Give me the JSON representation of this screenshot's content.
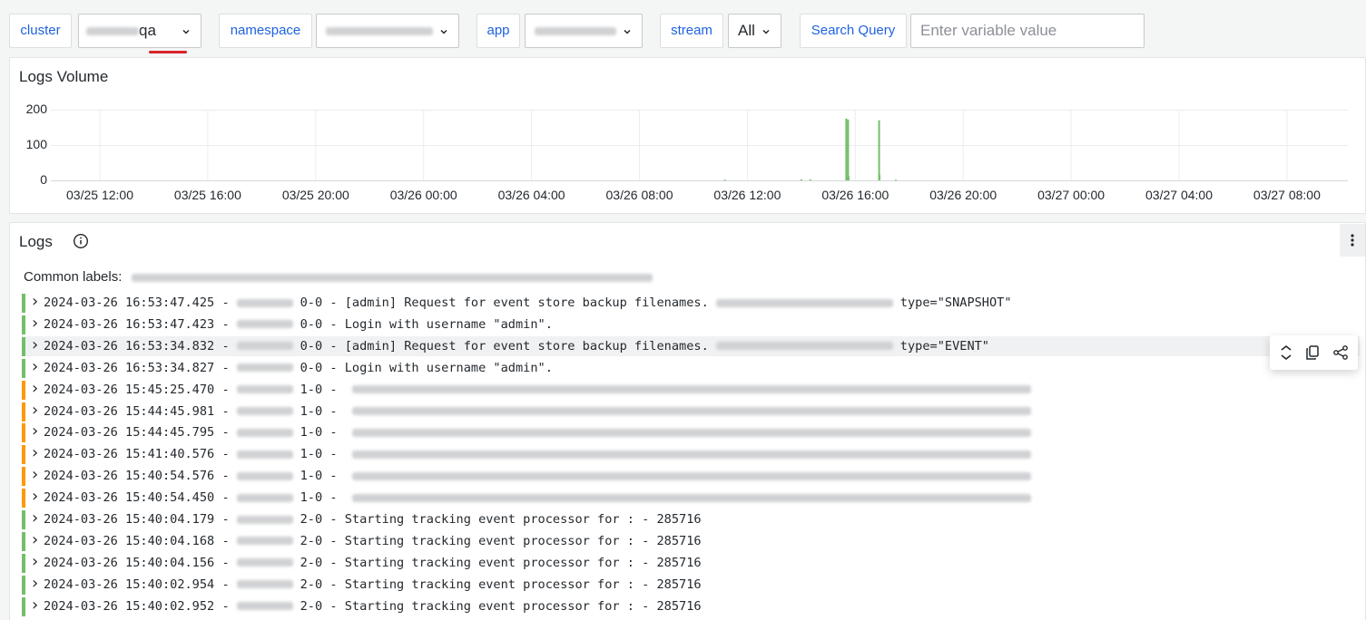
{
  "variables": {
    "cluster": {
      "label": "cluster",
      "value": "qa"
    },
    "namespace": {
      "label": "namespace"
    },
    "app": {
      "label": "app"
    },
    "stream": {
      "label": "stream",
      "value": "All"
    },
    "search": {
      "label": "Search Query",
      "placeholder": "Enter variable value"
    }
  },
  "volume_panel": {
    "title": "Logs Volume",
    "chart_data": {
      "type": "bar",
      "yticks": [
        "200",
        "100",
        "0"
      ],
      "ylim": [
        0,
        200
      ],
      "xticks": [
        "03/25 12:00",
        "03/25 16:00",
        "03/25 20:00",
        "03/26 00:00",
        "03/26 04:00",
        "03/26 08:00",
        "03/26 12:00",
        "03/26 16:00",
        "03/26 20:00",
        "03/27 00:00",
        "03/27 04:00",
        "03/27 08:00"
      ],
      "series": [
        {
          "color": "#73bf69",
          "values": [
            {
              "x": "03/26 15:40",
              "y": 175
            },
            {
              "x": "03/26 15:41",
              "y": 10
            },
            {
              "x": "03/26 15:44",
              "y": 172
            },
            {
              "x": "03/26 15:45",
              "y": 12
            },
            {
              "x": "03/26 16:53",
              "y": 170
            },
            {
              "x": "03/26 16:54",
              "y": 15
            },
            {
              "x": "03/26 14:00",
              "y": 3
            },
            {
              "x": "03/26 14:20",
              "y": 3
            },
            {
              "x": "03/26 17:30",
              "y": 2
            },
            {
              "x": "03/26 11:10",
              "y": 2
            }
          ]
        }
      ],
      "grid": true
    }
  },
  "logs_panel": {
    "title": "Logs",
    "common_labels_label": "Common labels:",
    "rows": [
      {
        "level": "info",
        "ts": "2024-03-26 16:53:47.425",
        "sep1": "-",
        "shard": "0-0",
        "sep2": "-",
        "msg": "[admin] Request for event store backup filenames.",
        "tail": "type=\"SNAPSHOT\""
      },
      {
        "level": "info",
        "ts": "2024-03-26 16:53:47.423",
        "sep1": "-",
        "shard": "0-0",
        "sep2": "-",
        "msg": "Login with username \"admin\".",
        "tail": ""
      },
      {
        "level": "info",
        "ts": "2024-03-26 16:53:34.832",
        "sep1": "-",
        "shard": "0-0",
        "sep2": "-",
        "msg": "[admin] Request for event store backup filenames.",
        "tail": "type=\"EVENT\""
      },
      {
        "level": "info",
        "ts": "2024-03-26 16:53:34.827",
        "sep1": "-",
        "shard": "0-0",
        "sep2": "-",
        "msg": "Login with username \"admin\".",
        "tail": ""
      },
      {
        "level": "warn",
        "ts": "2024-03-26 15:45:25.470",
        "sep1": "-",
        "shard": "1-0",
        "sep2": "-",
        "msg": "",
        "tail": ""
      },
      {
        "level": "warn",
        "ts": "2024-03-26 15:44:45.981",
        "sep1": "-",
        "shard": "1-0",
        "sep2": "-",
        "msg": "",
        "tail": ""
      },
      {
        "level": "warn",
        "ts": "2024-03-26 15:44:45.795",
        "sep1": "-",
        "shard": "1-0",
        "sep2": "-",
        "msg": "",
        "tail": ""
      },
      {
        "level": "warn",
        "ts": "2024-03-26 15:41:40.576",
        "sep1": "-",
        "shard": "1-0",
        "sep2": "-",
        "msg": "",
        "tail": ""
      },
      {
        "level": "warn",
        "ts": "2024-03-26 15:40:54.576",
        "sep1": "-",
        "shard": "1-0",
        "sep2": "-",
        "msg": "",
        "tail": ""
      },
      {
        "level": "warn",
        "ts": "2024-03-26 15:40:54.450",
        "sep1": "-",
        "shard": "1-0",
        "sep2": "-",
        "msg": "",
        "tail": ""
      },
      {
        "level": "info",
        "ts": "2024-03-26 15:40:04.179",
        "sep1": "-",
        "shard": "2-0",
        "sep2": "-",
        "msg": "Starting tracking event processor for : - 285716",
        "tail": ""
      },
      {
        "level": "info",
        "ts": "2024-03-26 15:40:04.168",
        "sep1": "-",
        "shard": "2-0",
        "sep2": "-",
        "msg": "Starting tracking event processor for : - 285716",
        "tail": ""
      },
      {
        "level": "info",
        "ts": "2024-03-26 15:40:04.156",
        "sep1": "-",
        "shard": "2-0",
        "sep2": "-",
        "msg": "Starting tracking event processor for : - 285716",
        "tail": ""
      },
      {
        "level": "info",
        "ts": "2024-03-26 15:40:02.954",
        "sep1": "-",
        "shard": "2-0",
        "sep2": "-",
        "msg": "Starting tracking event processor for : - 285716",
        "tail": ""
      },
      {
        "level": "info",
        "ts": "2024-03-26 15:40:02.952",
        "sep1": "-",
        "shard": "2-0",
        "sep2": "-",
        "msg": "Starting tracking event processor for : - 285716",
        "tail": ""
      }
    ]
  },
  "colors": {
    "accent": "#1f62e0",
    "info": "#73bf69",
    "warn": "#ff9900",
    "marker": "#d8222a"
  },
  "icons": {
    "chevron": "chevron-down-icon",
    "info": "info-circle-icon",
    "kebab": "kebab-menu-icon",
    "expander": "chevron-right-icon",
    "fold": "unfold-vertical-icon",
    "copy": "copy-icon",
    "share": "share-icon"
  }
}
